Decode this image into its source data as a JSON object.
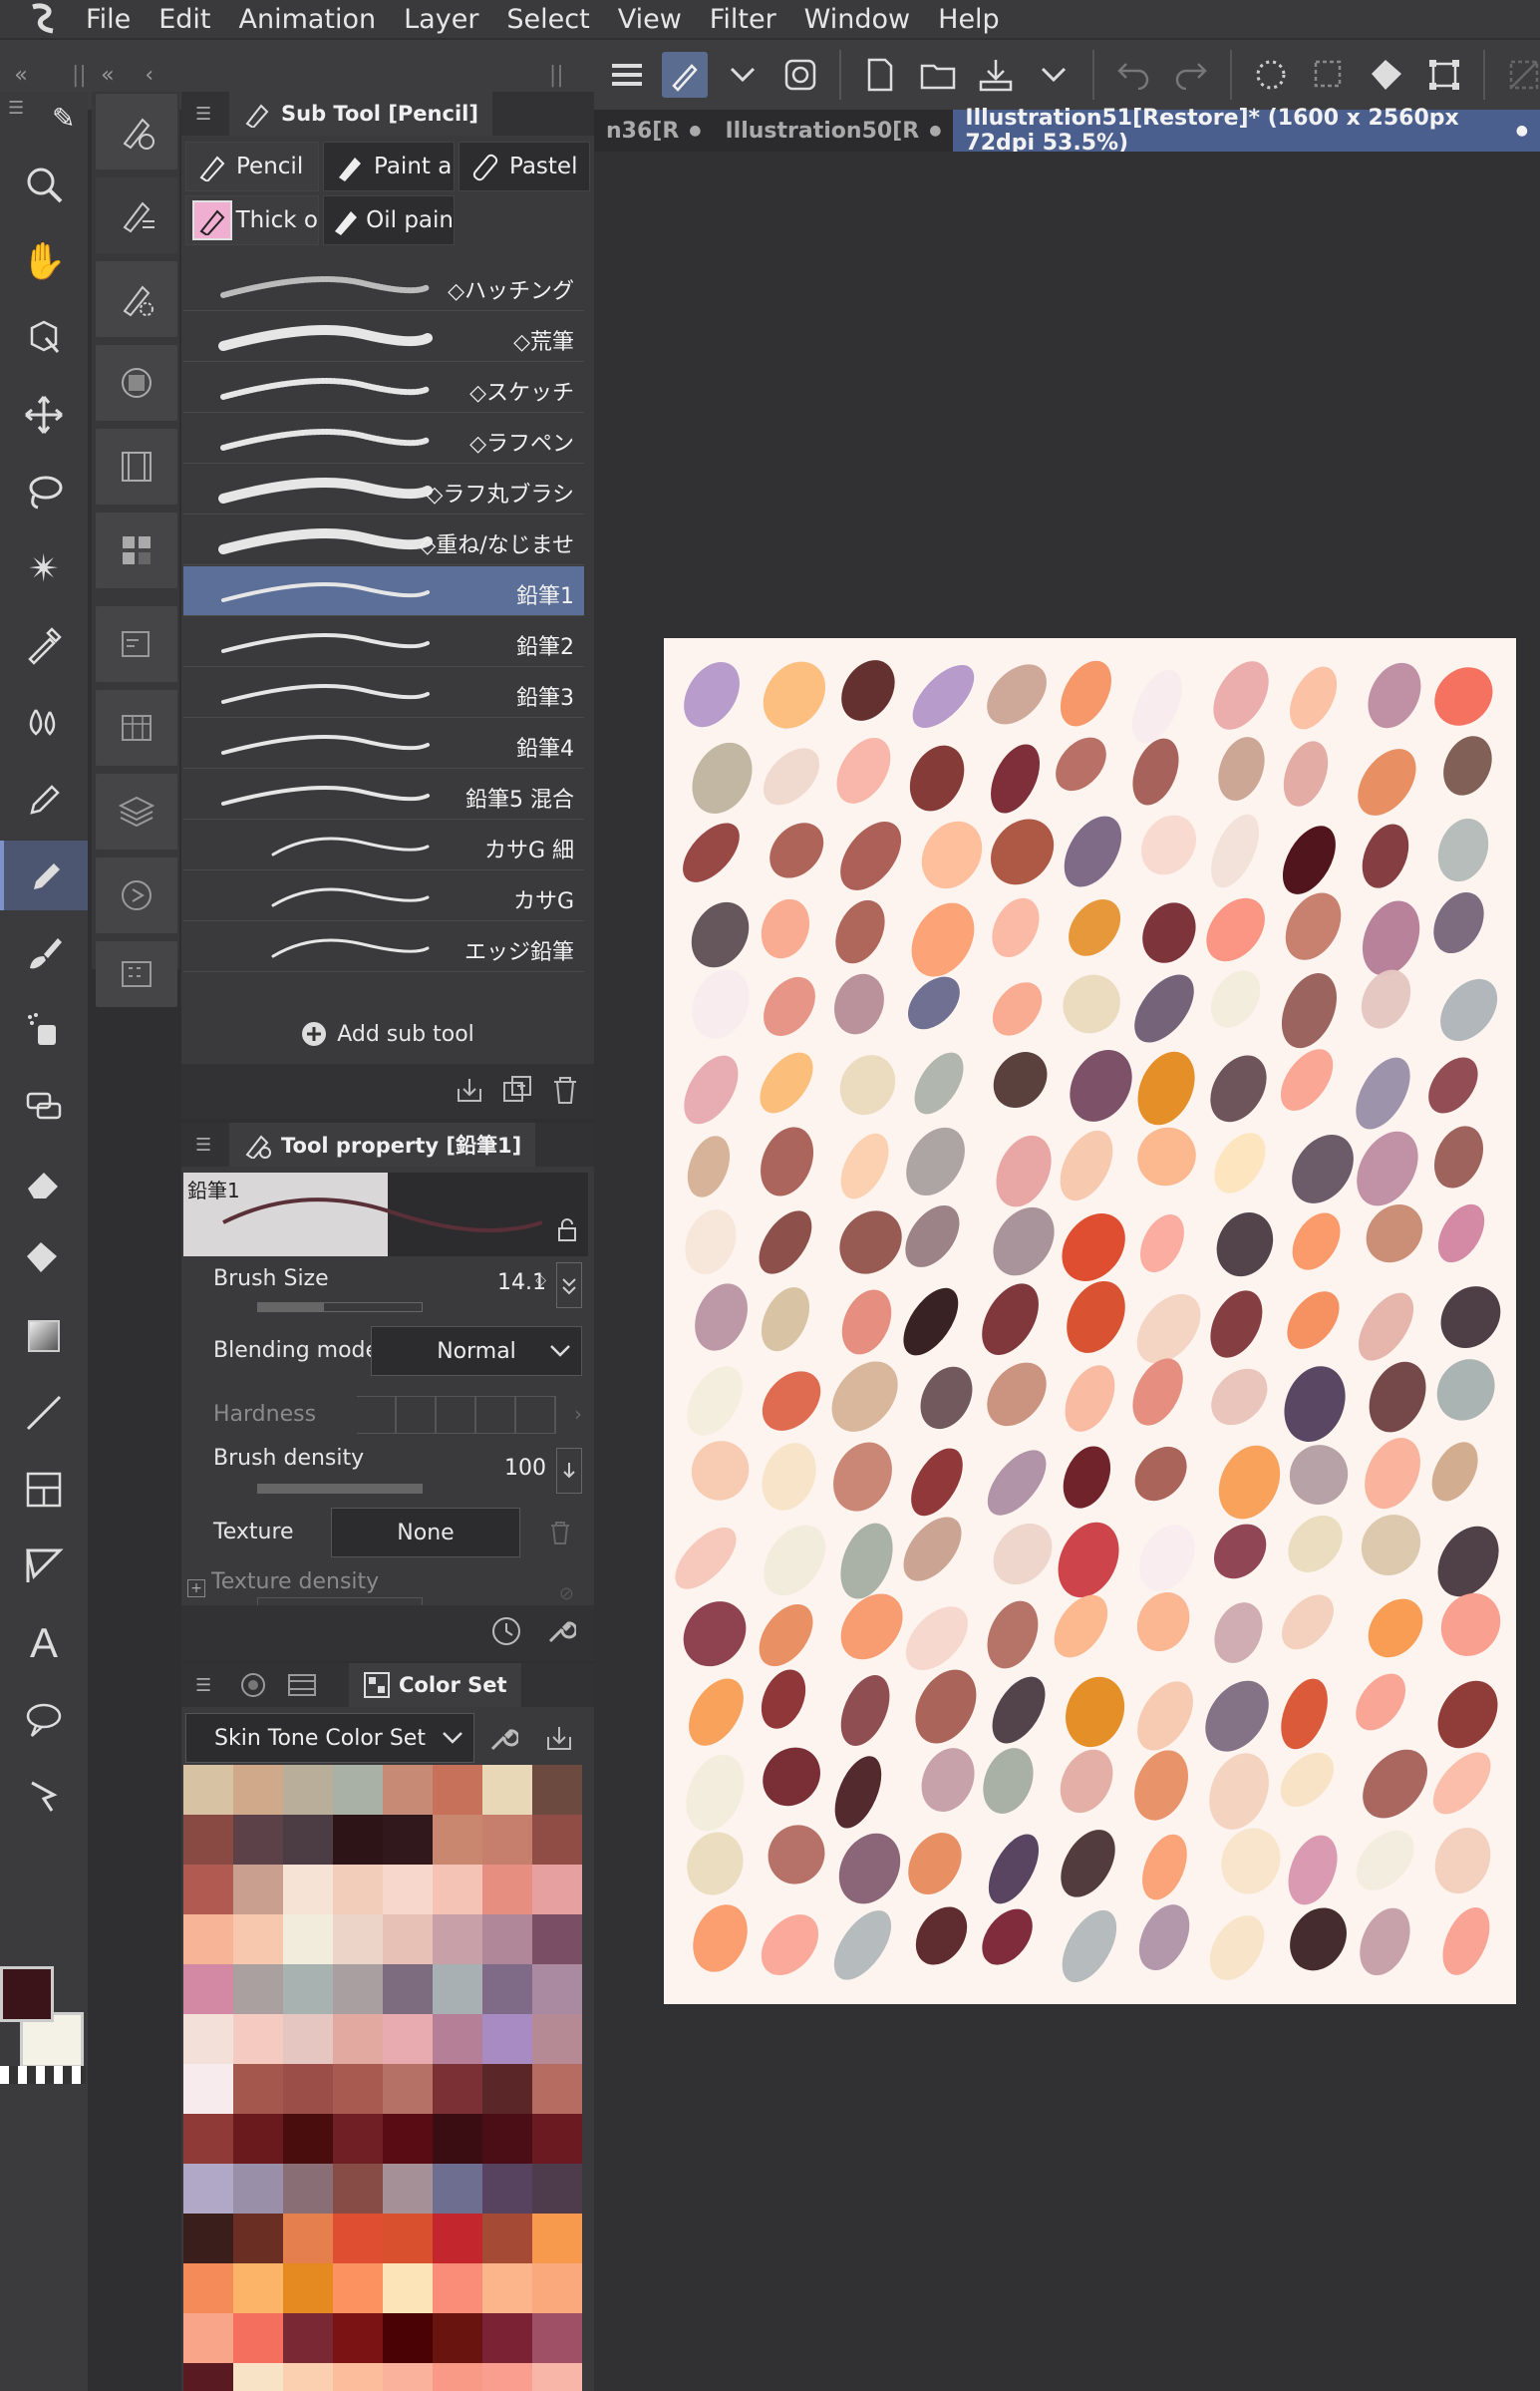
{
  "menu": [
    "File",
    "Edit",
    "Animation",
    "Layer",
    "Select",
    "View",
    "Filter",
    "Window",
    "Help"
  ],
  "canvas_tabs": [
    "n36[R",
    "Illustration50[R",
    "Illustration51[Restore]* (1600 x 2560px 72dpi 53.5%)"
  ],
  "subtool": {
    "title": "Sub Tool [Pencil]",
    "groups": [
      "Pencil",
      "Paint a",
      "Pastel",
      "Thick o",
      "Oil pain"
    ],
    "brushes": [
      "◇ハッチング",
      "◇荒筆",
      "◇スケッチ",
      "◇ラフペン",
      "◇ラフ丸ブラシ",
      "◇重ね/なじませ",
      "鉛筆1",
      "鉛筆2",
      "鉛筆3",
      "鉛筆4",
      "鉛筆5 混合",
      "カサG 細",
      "カサG",
      "エッジ鉛筆"
    ],
    "selected_brush": "鉛筆1",
    "add_label": "Add sub tool"
  },
  "toolprop": {
    "title": "Tool property [鉛筆1]",
    "preview_label": "鉛筆1",
    "brush_size_label": "Brush Size",
    "brush_size": "14.1",
    "blending_label": "Blending mode",
    "blending_value": "Normal",
    "hardness_label": "Hardness",
    "density_label": "Brush density",
    "density_value": "100",
    "texture_label": "Texture",
    "texture_value": "None",
    "texture_density_label": "Texture density"
  },
  "colorset": {
    "title": "Color Set",
    "set_name": "Skin Tone Color Set",
    "swatches": [
      "#d8c2a4",
      "#d0a98a",
      "#b9ae99",
      "#a9b0a6",
      "#c68a75",
      "#c7705a",
      "#e8d8b8",
      "#6d4a40",
      "#8a4a44",
      "#5c4148",
      "#4c3c44",
      "#2d1416",
      "#31181c",
      "#c8876e",
      "#c77f6d",
      "#8f4d46",
      "#b05a52",
      "#c9a08f",
      "#f6e3d6",
      "#f2cdb9",
      "#f7d6cc",
      "#f5c3b5",
      "#e68e80",
      "#e7a0a0",
      "#f8b496",
      "#f7c8ad",
      "#f2ecdc",
      "#edd4c9",
      "#e7c0b6",
      "#c7a0a8",
      "#b08798",
      "#7a4f66",
      "#d388a3",
      "#aaa0a0",
      "#a8b2b0",
      "#a99ea0",
      "#7d6c80",
      "#a8b0b4",
      "#7f6a88",
      "#a98aa0",
      "#f2e0d9",
      "#f4cac1",
      "#e5c6c1",
      "#e2a9a0",
      "#e7abb0",
      "#b67f98",
      "#a98bc4",
      "#b58a94",
      "#f8ebee",
      "#a4574d",
      "#9b4e47",
      "#a95a50",
      "#b57166",
      "#7b3035",
      "#5a2628",
      "#b76c62",
      "#8f3a37",
      "#6a1a1c",
      "#4a0d0e",
      "#701f25",
      "#5a0c14",
      "#3a0d12",
      "#4b0d16",
      "#6b1a22",
      "#b1a8c8",
      "#9a8fa8",
      "#8a6e76",
      "#874c46",
      "#a69097",
      "#6d6e90",
      "#574360",
      "#4e3c4c",
      "#3a1e1c",
      "#6b2e22",
      "#e57f4e",
      "#df4e30",
      "#d9502f",
      "#c4262e",
      "#a54a34",
      "#f89a4d",
      "#f58b58",
      "#fbb468",
      "#e48a20",
      "#fb925f",
      "#fde3b8",
      "#f98d78",
      "#fcb58a",
      "#f9a97c",
      "#f8a58a",
      "#f56f5e",
      "#7a2833",
      "#7b1315",
      "#4a0205",
      "#6a1410",
      "#7b2335",
      "#a05066",
      "#5a1a22",
      "#f8e3c6",
      "#fbd0b0",
      "#fbbd9c",
      "#fab29c",
      "#f99a86",
      "#fa9f90",
      "#f8b6a8"
    ]
  },
  "colors": {
    "primary": "#3a1418",
    "secondary": "#f4f1e6",
    "accent": "#5b6f98"
  }
}
